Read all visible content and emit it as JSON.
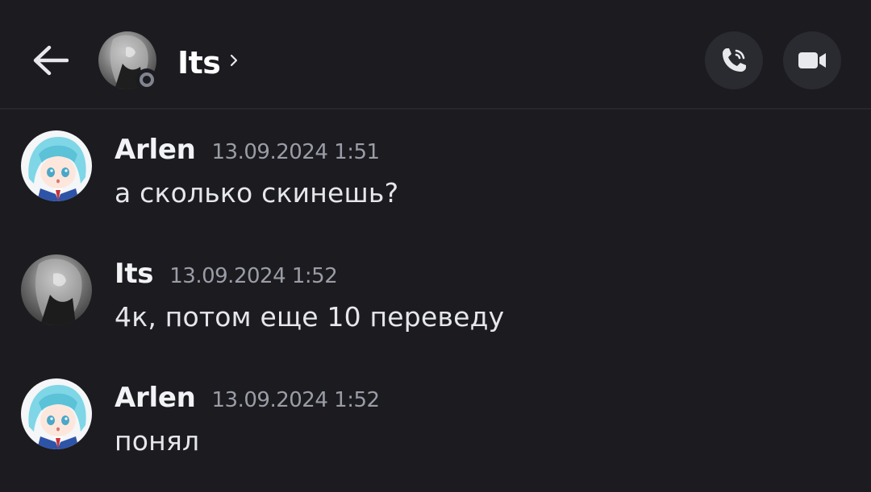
{
  "header": {
    "back_icon": "arrow-left-icon",
    "title": "Its",
    "title_chevron_icon": "chevron-right-icon",
    "status": "offline",
    "call_icon": "phone-call-icon",
    "video_icon": "video-camera-icon"
  },
  "messages": [
    {
      "author": "Arlen",
      "timestamp": "13.09.2024 1:51",
      "text": "а сколько скинешь?"
    },
    {
      "author": "Its",
      "timestamp": "13.09.2024 1:52",
      "text": "4к, потом еще 10 переведу"
    },
    {
      "author": "Arlen",
      "timestamp": "13.09.2024 1:52",
      "text": "понял"
    }
  ],
  "colors": {
    "background": "#1b1b20",
    "button_bg": "#2a2a31",
    "timestamp": "#9a9ca6",
    "offline_status": "#80848e",
    "arlen_avatar_hair": "#7fd6e6"
  }
}
